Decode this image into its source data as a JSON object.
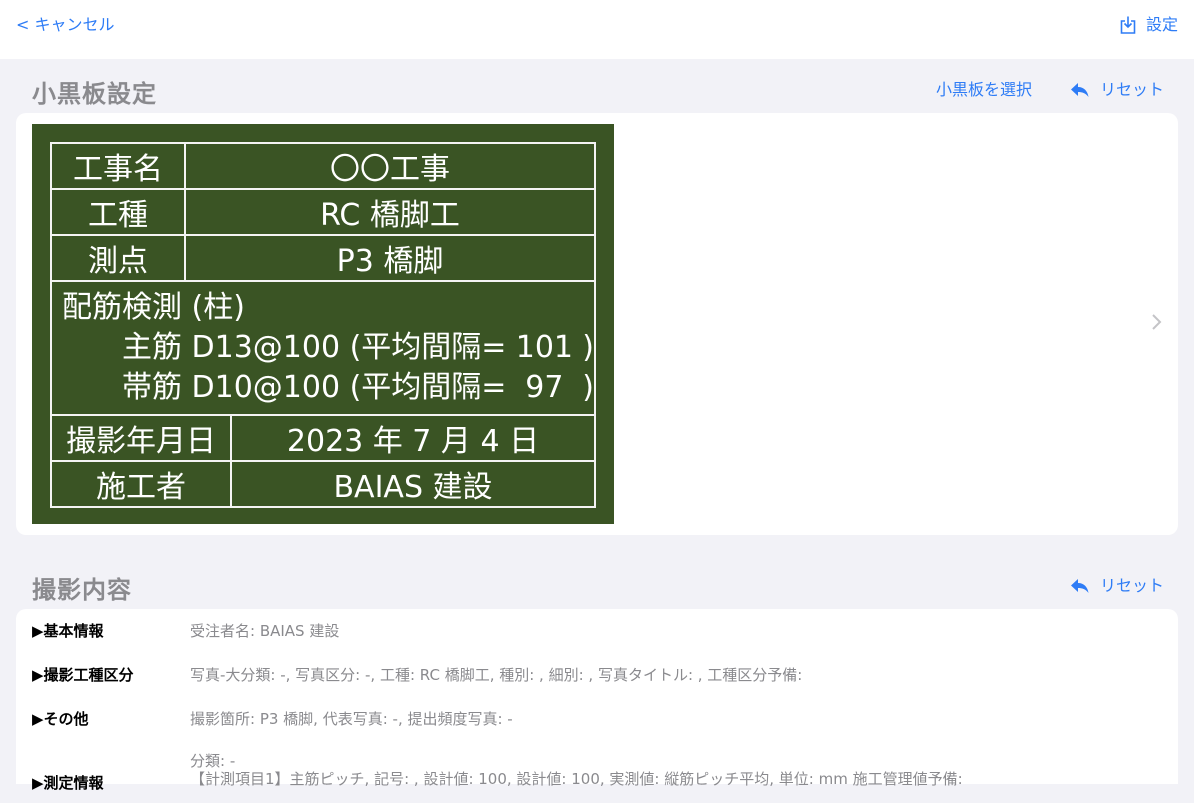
{
  "nav": {
    "cancel_label": "< キャンセル",
    "settings_label": "設定"
  },
  "blackboard_section": {
    "title": "小黒板設定",
    "select_label": "小黒板を選択",
    "reset_label": "リセット"
  },
  "blackboard": {
    "rows": [
      {
        "label": "工事名",
        "value": "〇〇工事"
      },
      {
        "label": "工種",
        "value": "RC 橋脚工"
      },
      {
        "label": "測点",
        "value": "P3 橋脚"
      }
    ],
    "check": {
      "title": "配筋検測 (柱)",
      "line1_prefix": "主筋 D13@100 (平均間隔=",
      "line1_value": "101",
      "line1_suffix": ")",
      "line2_prefix": "帯筋 D10@100 (平均間隔=",
      "line2_value": "97",
      "line2_suffix": ")"
    },
    "footer_rows": [
      {
        "label": "撮影年月日",
        "value": "2023 年 7 月 4 日"
      },
      {
        "label": "施工者",
        "value": "BAIAS 建設"
      }
    ]
  },
  "content_section": {
    "title": "撮影内容",
    "reset_label": "リセット",
    "rows": [
      {
        "label": "▶基本情報",
        "value": "受注者名: BAIAS 建設"
      },
      {
        "label": "▶撮影工種区分",
        "value": "写真-大分類: -, 写真区分: -, 工種: RC 橋脚工, 種別: , 細別: , 写真タイトル: , 工種区分予備:"
      },
      {
        "label": "▶その他",
        "value": "撮影箇所: P3 橋脚, 代表写真: -, 提出頻度写真: -"
      },
      {
        "label": "▶測定情報",
        "value": "分類: -",
        "value2": "【計測項目1】主筋ピッチ, 記号: , 設計値: 100, 設計値: 100, 実測値: 縦筋ピッチ平均, 単位: mm 施工管理値予備:"
      }
    ]
  },
  "colors": {
    "accent": "#2e7cf6",
    "board": "#3a5424",
    "background": "#f2f2f7"
  }
}
